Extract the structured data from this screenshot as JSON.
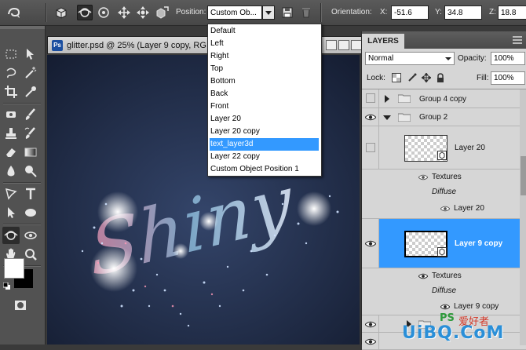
{
  "options_bar": {
    "position_label": "Position:",
    "position_value": "Custom Ob...",
    "orientation_label": "Orientation:",
    "x_label": "X:",
    "x_value": "-51.6",
    "y_label": "Y:",
    "y_value": "34.8",
    "z_label": "Z:",
    "z_value": "18.8"
  },
  "document": {
    "badge": "Ps",
    "title": "glitter.psd @ 25% (Layer 9 copy, RG"
  },
  "canvas": {
    "text": "Shiny"
  },
  "position_dropdown": {
    "items": [
      {
        "label": "Default"
      },
      {
        "label": "Left"
      },
      {
        "label": "Right"
      },
      {
        "label": "Top"
      },
      {
        "label": "Bottom"
      },
      {
        "label": "Back"
      },
      {
        "label": "Front"
      },
      {
        "label": "Layer 20"
      },
      {
        "label": "Layer 20 copy"
      },
      {
        "label": "text_layer3d"
      },
      {
        "label": "Layer 22 copy"
      },
      {
        "label": "Custom Object Position 1"
      }
    ],
    "selected_index": 9
  },
  "layers_panel": {
    "tab": "LAYERS",
    "blend_mode": "Normal",
    "opacity_label": "Opacity:",
    "opacity_value": "100%",
    "lock_label": "Lock:",
    "fill_label": "Fill:",
    "fill_value": "100%",
    "rows": {
      "group4": "Group 4 copy",
      "group2": "Group 2",
      "layer20": "Layer 20",
      "textures_a": "Textures",
      "diffuse_a": "Diffuse",
      "layer20_sub": "Layer 20",
      "layer9copy": "Layer 9 copy",
      "textures_b": "Textures",
      "diffuse_b": "Diffuse",
      "layer9copy_sub": "Layer 9 copy"
    }
  },
  "watermark": {
    "ps": "PS",
    "cn": "爱好者",
    "brand": "UiBQ.CoM"
  },
  "colors": {
    "selection": "#3399ff",
    "canvas_bg": "#1e2a44"
  }
}
